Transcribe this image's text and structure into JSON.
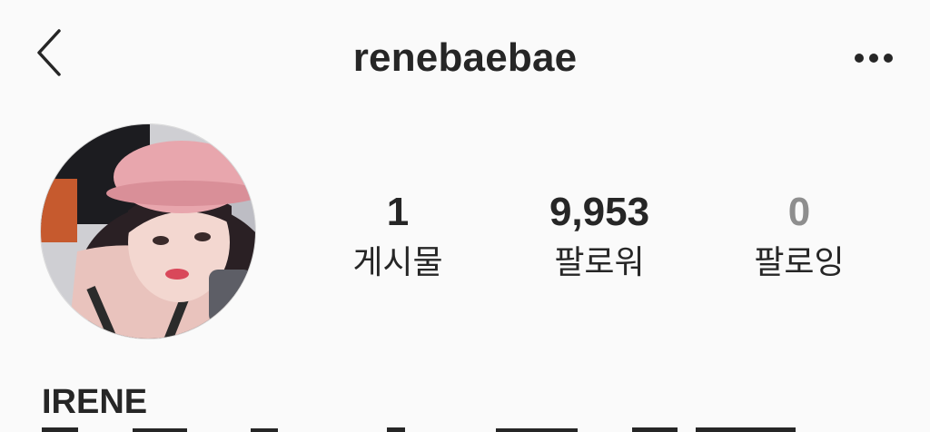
{
  "header": {
    "username": "renebaebae",
    "back_icon": "chevron-left-icon",
    "more_icon": "more-horizontal-icon"
  },
  "profile": {
    "avatar_icon": "profile-photo",
    "stats": [
      {
        "value": "1",
        "label": "게시물"
      },
      {
        "value": "9,953",
        "label": "팔로워"
      },
      {
        "value": "0",
        "label": "팔로잉"
      }
    ],
    "display_name": "IRENE"
  },
  "colors": {
    "background": "#fafafa",
    "text": "#262626",
    "muted": "#8e8e8e"
  }
}
